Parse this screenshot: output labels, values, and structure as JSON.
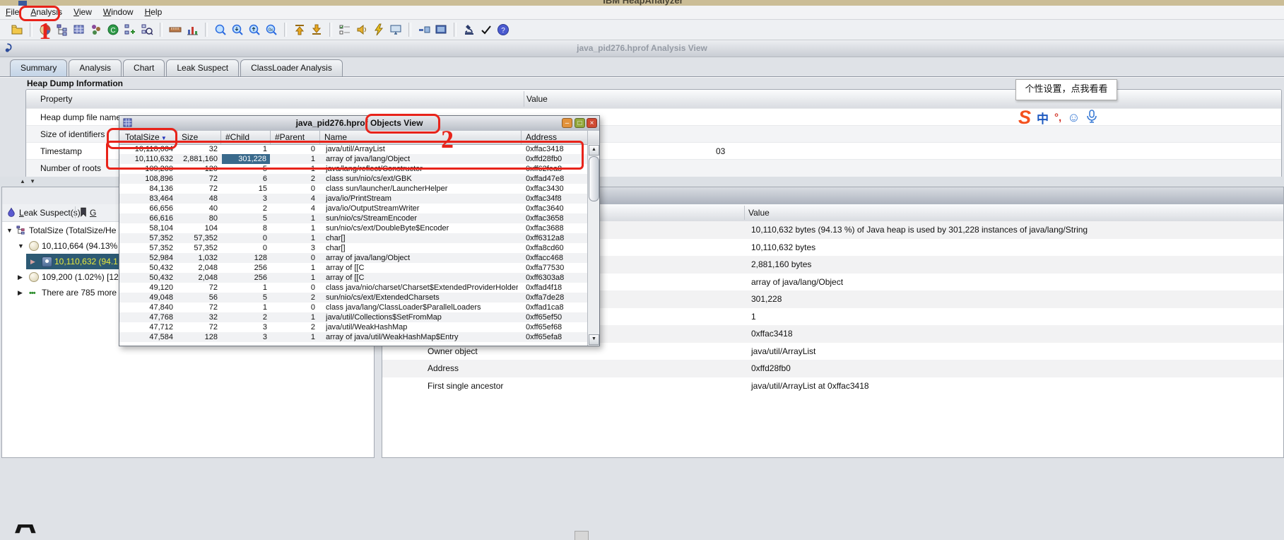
{
  "app": {
    "title": "IBM HeapAnalyzer"
  },
  "menu": {
    "items": [
      "File",
      "Analysis",
      "View",
      "Window",
      "Help"
    ]
  },
  "toolbar": {
    "groups": [
      [
        "open-file"
      ],
      [
        "pie-chart",
        "tree-view",
        "table-view",
        "object-cluster",
        "classloader-view",
        "add-tree",
        "search-tree"
      ],
      [
        "ruler",
        "bar-chart"
      ],
      [
        "zoom",
        "zoom-out",
        "zoom-in",
        "zoom-reset"
      ],
      [
        "scroll-top",
        "scroll-bottom"
      ],
      [
        "options-list",
        "alert-speaker",
        "launch-flash",
        "monitor-view"
      ],
      [
        "compact-view",
        "full-view"
      ],
      [
        "inspect-microscope",
        "confirm-check",
        "help"
      ]
    ]
  },
  "frame": {
    "title": "java_pid276.hprof Analysis View"
  },
  "tabs": {
    "active": "Summary",
    "items": [
      "Summary",
      "Analysis",
      "Chart",
      "Leak Suspect",
      "ClassLoader Analysis"
    ]
  },
  "heap_info": {
    "section_title": "Heap Dump Information",
    "columns": [
      "Property",
      "Value"
    ],
    "rows": [
      "Heap dump file name",
      "Size of identifiers",
      "Timestamp",
      "Number of roots"
    ],
    "timestamp_fragment": "03"
  },
  "leak": {
    "header": "Leak Suspect(s)",
    "go": "G",
    "tree": [
      {
        "level": 0,
        "arrow": "expanded",
        "icon": "tree-node",
        "text": "TotalSize (TotalSize/He",
        "selected": false
      },
      {
        "level": 1,
        "arrow": "expanded",
        "icon": "sphere",
        "text": "10,110,664 (94.13%",
        "selected": false
      },
      {
        "level": 2,
        "arrow": "collapsed",
        "icon": "object",
        "text": "10,110,632 (94.1",
        "selected": true
      },
      {
        "level": 1,
        "arrow": "collapsed",
        "icon": "sphere",
        "text": "109,200 (1.02%) [12",
        "selected": false
      },
      {
        "level": 1,
        "arrow": "collapsed",
        "icon": "more",
        "text": "There are 785 more",
        "selected": false
      }
    ]
  },
  "detail": {
    "value_header": "Value",
    "rows": [
      {
        "label": "",
        "value": "10,110,632 bytes (94.13 %) of Java heap is used by 301,228 instances of java/lang/String"
      },
      {
        "label": "",
        "value": "10,110,632 bytes"
      },
      {
        "label": "",
        "value": "2,881,160 bytes"
      },
      {
        "label": "",
        "value": "array of java/lang/Object"
      },
      {
        "label": "",
        "value": "301,228"
      },
      {
        "label": "",
        "value": "1"
      },
      {
        "label": "",
        "value": "0xffac3418"
      },
      {
        "label": "Owner object",
        "value": "java/util/ArrayList"
      },
      {
        "label": "Address",
        "value": "0xffd28fb0"
      },
      {
        "label": "First single ancestor",
        "value": "java/util/ArrayList at 0xffac3418"
      }
    ]
  },
  "objects_view": {
    "title_file": "java_pid276.hprof",
    "title_view": "Objects View",
    "sort_column": "TotalSize",
    "sort_indicator": "▼",
    "columns": [
      "TotalSize",
      "Size",
      "#Child",
      "#Parent",
      "Name",
      "Address"
    ],
    "selected_cell": {
      "row": 1,
      "col": 2
    },
    "rows": [
      [
        "10,110,664",
        "32",
        "1",
        "0",
        "java/util/ArrayList",
        "0xffac3418"
      ],
      [
        "10,110,632",
        "2,881,160",
        "301,228",
        "1",
        "array of java/lang/Object",
        "0xffd28fb0"
      ],
      [
        "109,200",
        "120",
        "5",
        "1",
        "java/lang/reflect/Constructor",
        "0xff62fea8"
      ],
      [
        "108,896",
        "72",
        "6",
        "2",
        "class sun/nio/cs/ext/GBK",
        "0xffad47e8"
      ],
      [
        "84,136",
        "72",
        "15",
        "0",
        "class sun/launcher/LauncherHelper",
        "0xffac3430"
      ],
      [
        "83,464",
        "48",
        "3",
        "4",
        "java/io/PrintStream",
        "0xffac34f8"
      ],
      [
        "66,656",
        "40",
        "2",
        "4",
        "java/io/OutputStreamWriter",
        "0xffac3640"
      ],
      [
        "66,616",
        "80",
        "5",
        "1",
        "sun/nio/cs/StreamEncoder",
        "0xffac3658"
      ],
      [
        "58,104",
        "104",
        "8",
        "1",
        "sun/nio/cs/ext/DoubleByte$Encoder",
        "0xffac3688"
      ],
      [
        "57,352",
        "57,352",
        "0",
        "1",
        "char[]",
        "0xff6312a8"
      ],
      [
        "57,352",
        "57,352",
        "0",
        "3",
        "char[]",
        "0xffa8cd60"
      ],
      [
        "52,984",
        "1,032",
        "128",
        "0",
        "array of java/lang/Object",
        "0xffacc468"
      ],
      [
        "50,432",
        "2,048",
        "256",
        "1",
        "array of [[C",
        "0xffa77530"
      ],
      [
        "50,432",
        "2,048",
        "256",
        "1",
        "array of [[C",
        "0xff6303a8"
      ],
      [
        "49,120",
        "72",
        "1",
        "0",
        "class java/nio/charset/Charset$ExtendedProviderHolder",
        "0xffad4f18"
      ],
      [
        "49,048",
        "56",
        "5",
        "2",
        "sun/nio/cs/ext/ExtendedCharsets",
        "0xffa7de28"
      ],
      [
        "47,840",
        "72",
        "1",
        "0",
        "class java/lang/ClassLoader$ParallelLoaders",
        "0xffad1ca8"
      ],
      [
        "47,768",
        "32",
        "2",
        "1",
        "java/util/Collections$SetFromMap",
        "0xff65ef50"
      ],
      [
        "47,712",
        "72",
        "3",
        "2",
        "java/util/WeakHashMap",
        "0xff65ef68"
      ],
      [
        "47,584",
        "128",
        "3",
        "1",
        "array of java/util/WeakHashMap$Entry",
        "0xff65efa8"
      ]
    ]
  },
  "annotations": {
    "color": "#e8231a",
    "step1": "1",
    "step2": "2"
  },
  "ime": {
    "tooltip": "个性设置，点我看看",
    "zh": "中",
    "punct": "°,",
    "smile": "☺"
  }
}
